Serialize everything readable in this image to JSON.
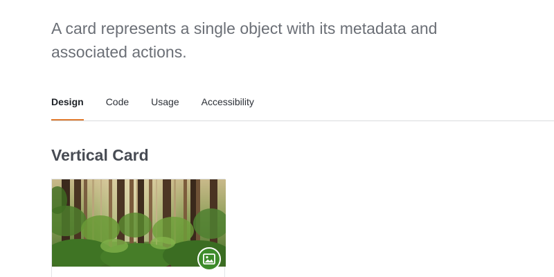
{
  "intro": {
    "text": "A card represents a single object with its metadata and associated actions."
  },
  "tabs": [
    {
      "label": "Design",
      "active": true
    },
    {
      "label": "Code",
      "active": false
    },
    {
      "label": "Usage",
      "active": false
    },
    {
      "label": "Accessibility",
      "active": false
    }
  ],
  "section": {
    "title": "Vertical Card"
  },
  "card": {
    "image_icon": "image-icon",
    "badge_color": "#3d8b2a"
  },
  "colors": {
    "accent": "#e07a2e",
    "divider": "#d9dbde"
  }
}
